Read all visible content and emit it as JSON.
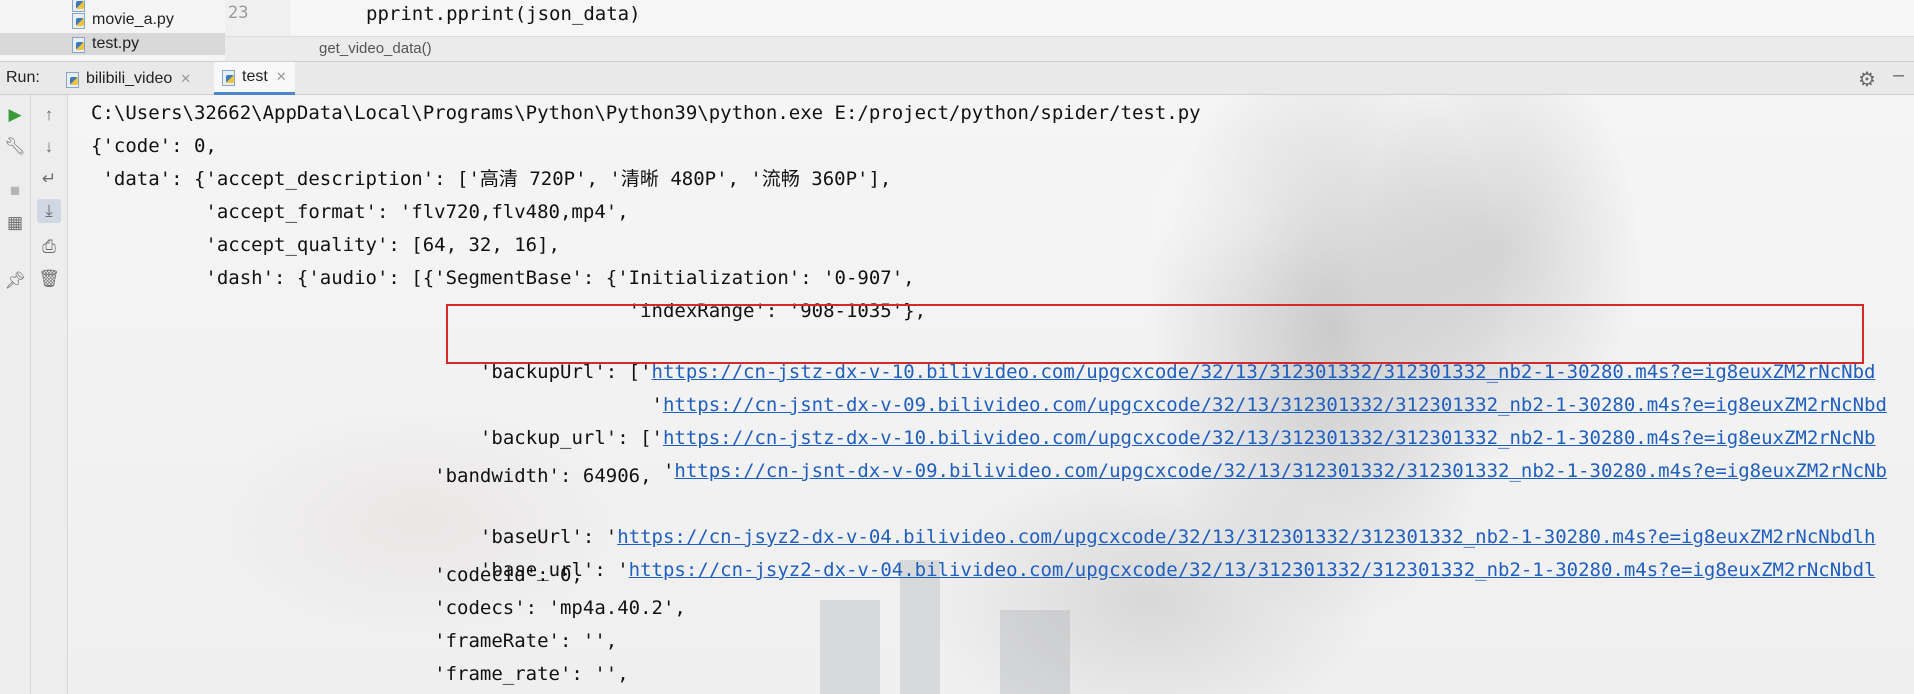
{
  "project": {
    "files": [
      "movie_a.py",
      "test.py"
    ],
    "selected": "test.py"
  },
  "editor": {
    "line_number": "23",
    "code": "pprint.pprint(json_data)",
    "breadcrumb": "get_video_data()"
  },
  "run": {
    "label": "Run:",
    "tabs": [
      {
        "label": "bilibili_video"
      },
      {
        "label": "test"
      }
    ]
  },
  "console": {
    "lines": [
      "C:\\Users\\32662\\AppData\\Local\\Programs\\Python\\Python39\\python.exe E:/project/python/spider/test.py",
      "{'code': 0,",
      " 'data': {'accept_description': ['高清 720P', '清晰 480P', '流畅 360P'],",
      "          'accept_format': 'flv720,flv480,mp4',",
      "          'accept_quality': [64, 32, 16],",
      "          'dash': {'audio': [{'SegmentBase': {'Initialization': '0-907',",
      "                                               'indexRange': '908-1035'},",
      "                              'backupUrl': ['",
      "                                             '",
      "                              'backup_url': ['",
      "                                              '",
      "                              'bandwidth': 64906,",
      "                              'baseUrl': '",
      "                              'base_url': '",
      "                              'codecid': 0,",
      "                              'codecs': 'mp4a.40.2',",
      "                              'frameRate': '',",
      "                              'frame_rate': '',"
    ],
    "urls": [
      "https://cn-jstz-dx-v-10.bilivideo.com/upgcxcode/32/13/312301332/312301332_nb2-1-30280.m4s?e=ig8euxZM2rNcNbd",
      "https://cn-jsnt-dx-v-09.bilivideo.com/upgcxcode/32/13/312301332/312301332_nb2-1-30280.m4s?e=ig8euxZM2rNcNbd",
      "https://cn-jstz-dx-v-10.bilivideo.com/upgcxcode/32/13/312301332/312301332_nb2-1-30280.m4s?e=ig8euxZM2rNcNb",
      "https://cn-jsnt-dx-v-09.bilivideo.com/upgcxcode/32/13/312301332/312301332_nb2-1-30280.m4s?e=ig8euxZM2rNcNb",
      "https://cn-jsyz2-dx-v-04.bilivideo.com/upgcxcode/32/13/312301332/312301332_nb2-1-30280.m4s?e=ig8euxZM2rNcNbdlh",
      "https://cn-jsyz2-dx-v-04.bilivideo.com/upgcxcode/32/13/312301332/312301332_nb2-1-30280.m4s?e=ig8euxZM2rNcNbdl"
    ]
  },
  "colors": {
    "link": "#1f5fbf",
    "highlight_border": "#d42a2a",
    "active_tab": "#4a88c7",
    "run_icon": "#3b9a3b"
  },
  "icons": [
    "python-file-icon",
    "run-icon",
    "wrench-icon",
    "stop-icon",
    "layout-icon",
    "pin-icon",
    "up-arrow-icon",
    "down-arrow-icon",
    "soft-wrap-icon",
    "scroll-to-end-icon",
    "print-icon",
    "trash-icon",
    "gear-icon",
    "minimize-icon"
  ]
}
